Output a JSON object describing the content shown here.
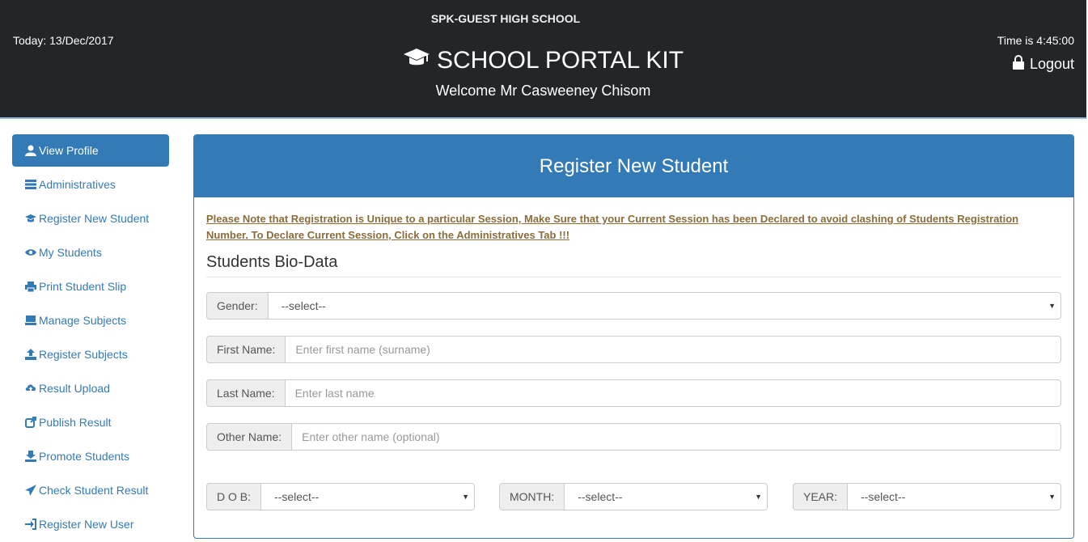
{
  "header": {
    "school_name": "SPK-GUEST HIGH SCHOOL",
    "today": "Today: 13/Dec/2017",
    "time": "Time is 4:45:00",
    "brand": "SCHOOL PORTAL KIT",
    "brand_icon": "graduation-cap-icon",
    "welcome": "Welcome Mr Casweeney Chisom",
    "logout_label": "Logout"
  },
  "sidebar": {
    "items": [
      {
        "label": "View Profile",
        "icon": "user-icon",
        "active": true
      },
      {
        "label": "Administratives",
        "icon": "list-icon"
      },
      {
        "label": "Register New Student",
        "icon": "graduation-cap-icon"
      },
      {
        "label": "My Students",
        "icon": "eye-icon"
      },
      {
        "label": "Print Student Slip",
        "icon": "print-icon"
      },
      {
        "label": "Manage Subjects",
        "icon": "monitor-icon"
      },
      {
        "label": "Register Subjects",
        "icon": "upload-icon"
      },
      {
        "label": "Result Upload",
        "icon": "cloud-upload-icon"
      },
      {
        "label": "Publish Result",
        "icon": "share-icon"
      },
      {
        "label": "Promote Students",
        "icon": "promote-icon"
      },
      {
        "label": "Check Student Result",
        "icon": "send-icon"
      },
      {
        "label": "Register New User",
        "icon": "login-icon"
      }
    ]
  },
  "panel": {
    "title": "Register New Student",
    "notice": "Please Note that Registration is Unique to a particular Session, Make Sure that your Current Session has been Declared to avoid clashing of Students Registration Number. To Declare Current Session, Click on the Administratives Tab !!!",
    "section_title": "Students Bio-Data",
    "gender": {
      "label": "Gender:",
      "value": "--select--"
    },
    "first_name": {
      "label": "First Name:",
      "placeholder": "Enter first name (surname)"
    },
    "last_name": {
      "label": "Last Name:",
      "placeholder": "Enter last name"
    },
    "other_name": {
      "label": "Other Name:",
      "placeholder": "Enter other name (optional)"
    },
    "dob": {
      "label": "D O B:",
      "value": "--select--"
    },
    "month": {
      "label": "MONTH:",
      "value": "--select--"
    },
    "year": {
      "label": "YEAR:",
      "value": "--select--"
    }
  },
  "colors": {
    "header_bg": "#222629",
    "primary": "#337ab7",
    "notice": "#8a6d3b"
  }
}
